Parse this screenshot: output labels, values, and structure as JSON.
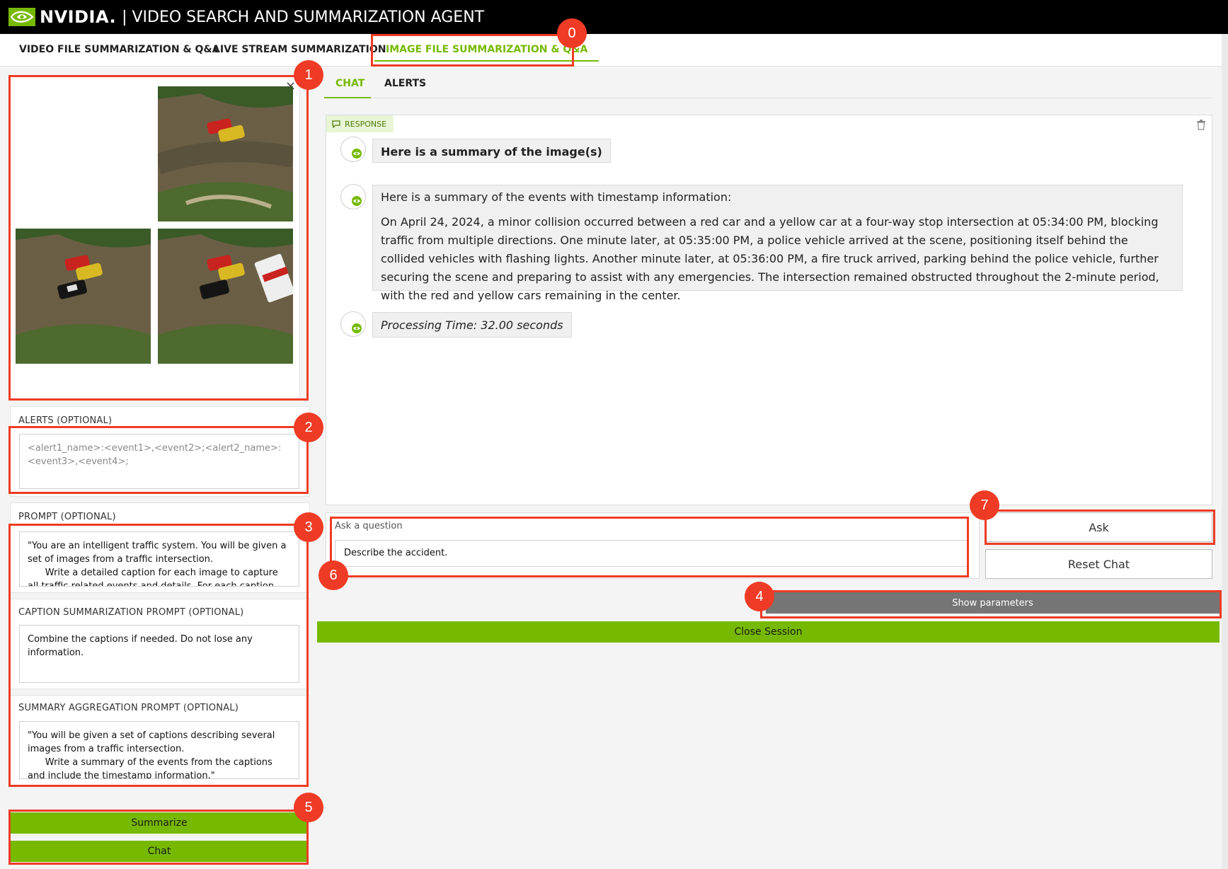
{
  "header": {
    "brand": "NVIDIA.",
    "title": "| VIDEO SEARCH AND SUMMARIZATION AGENT"
  },
  "tabs": [
    {
      "label": "VIDEO FILE SUMMARIZATION & Q&A",
      "active": false
    },
    {
      "label": "LIVE STREAM SUMMARIZATION",
      "active": false
    },
    {
      "label": "IMAGE FILE SUMMARIZATION & Q&A",
      "active": true
    }
  ],
  "gallery": {
    "close_symbol": "×",
    "thumbnails": [
      {
        "icon": "image-intersection-two-cars"
      },
      {
        "icon": "image-intersection-police-car"
      },
      {
        "icon": "image-intersection-fire-truck"
      }
    ]
  },
  "alerts": {
    "label": "ALERTS (OPTIONAL)",
    "placeholder": "<alert1_name>:<event1>,<event2>;<alert2_name>:<event3>,<event4>;"
  },
  "prompt": {
    "label": "PROMPT (OPTIONAL)",
    "value": "\"You are an intelligent traffic system. You will be given a set of images from a traffic intersection.\n      Write a detailed caption for each image to capture all traffic related events and details. For each caption"
  },
  "caption_prompt": {
    "label": "CAPTION SUMMARIZATION PROMPT (OPTIONAL)",
    "value": "Combine the captions if needed. Do not lose any information."
  },
  "aggregation_prompt": {
    "label": "SUMMARY AGGREGATION PROMPT (OPTIONAL)",
    "value": "\"You will be given a set of captions describing several images from a traffic intersection.\n      Write a summary of the events from the captions and include the timestamp information.\""
  },
  "left_buttons": {
    "summarize": "Summarize",
    "chat": "Chat"
  },
  "chat_tabs": [
    {
      "label": "CHAT",
      "active": true
    },
    {
      "label": "ALERTS",
      "active": false
    }
  ],
  "chat": {
    "badge": "RESPONSE",
    "messages": [
      {
        "text": "Here is a summary of the image(s)"
      },
      {
        "intro": "Here is a summary of the events with timestamp information:",
        "text": "On April 24, 2024, a minor collision occurred between a red car and a yellow car at a four-way stop intersection at 05:34:00 PM, blocking traffic from multiple directions. One minute later, at 05:35:00 PM, a police vehicle arrived at the scene, positioning itself behind the collided vehicles with flashing lights. Another minute later, at 05:36:00 PM, a fire truck arrived, parking behind the police vehicle, further securing the scene and preparing to assist with any emergencies. The intersection remained obstructed throughout the 2-minute period, with the red and yellow cars remaining in the center."
      },
      {
        "text": "Processing Time: 32.00 seconds"
      }
    ]
  },
  "question": {
    "label": "Ask a question",
    "value": "Describe the accident."
  },
  "right_buttons": {
    "ask": "Ask",
    "reset": "Reset Chat",
    "show_params": "Show parameters",
    "close_session": "Close Session"
  },
  "markers": [
    "0",
    "1",
    "2",
    "3",
    "4",
    "5",
    "6",
    "7"
  ],
  "colors": {
    "accent": "#76b900",
    "marker": "#ef3b25",
    "header_bg": "#000000",
    "gray_button": "#757575"
  }
}
